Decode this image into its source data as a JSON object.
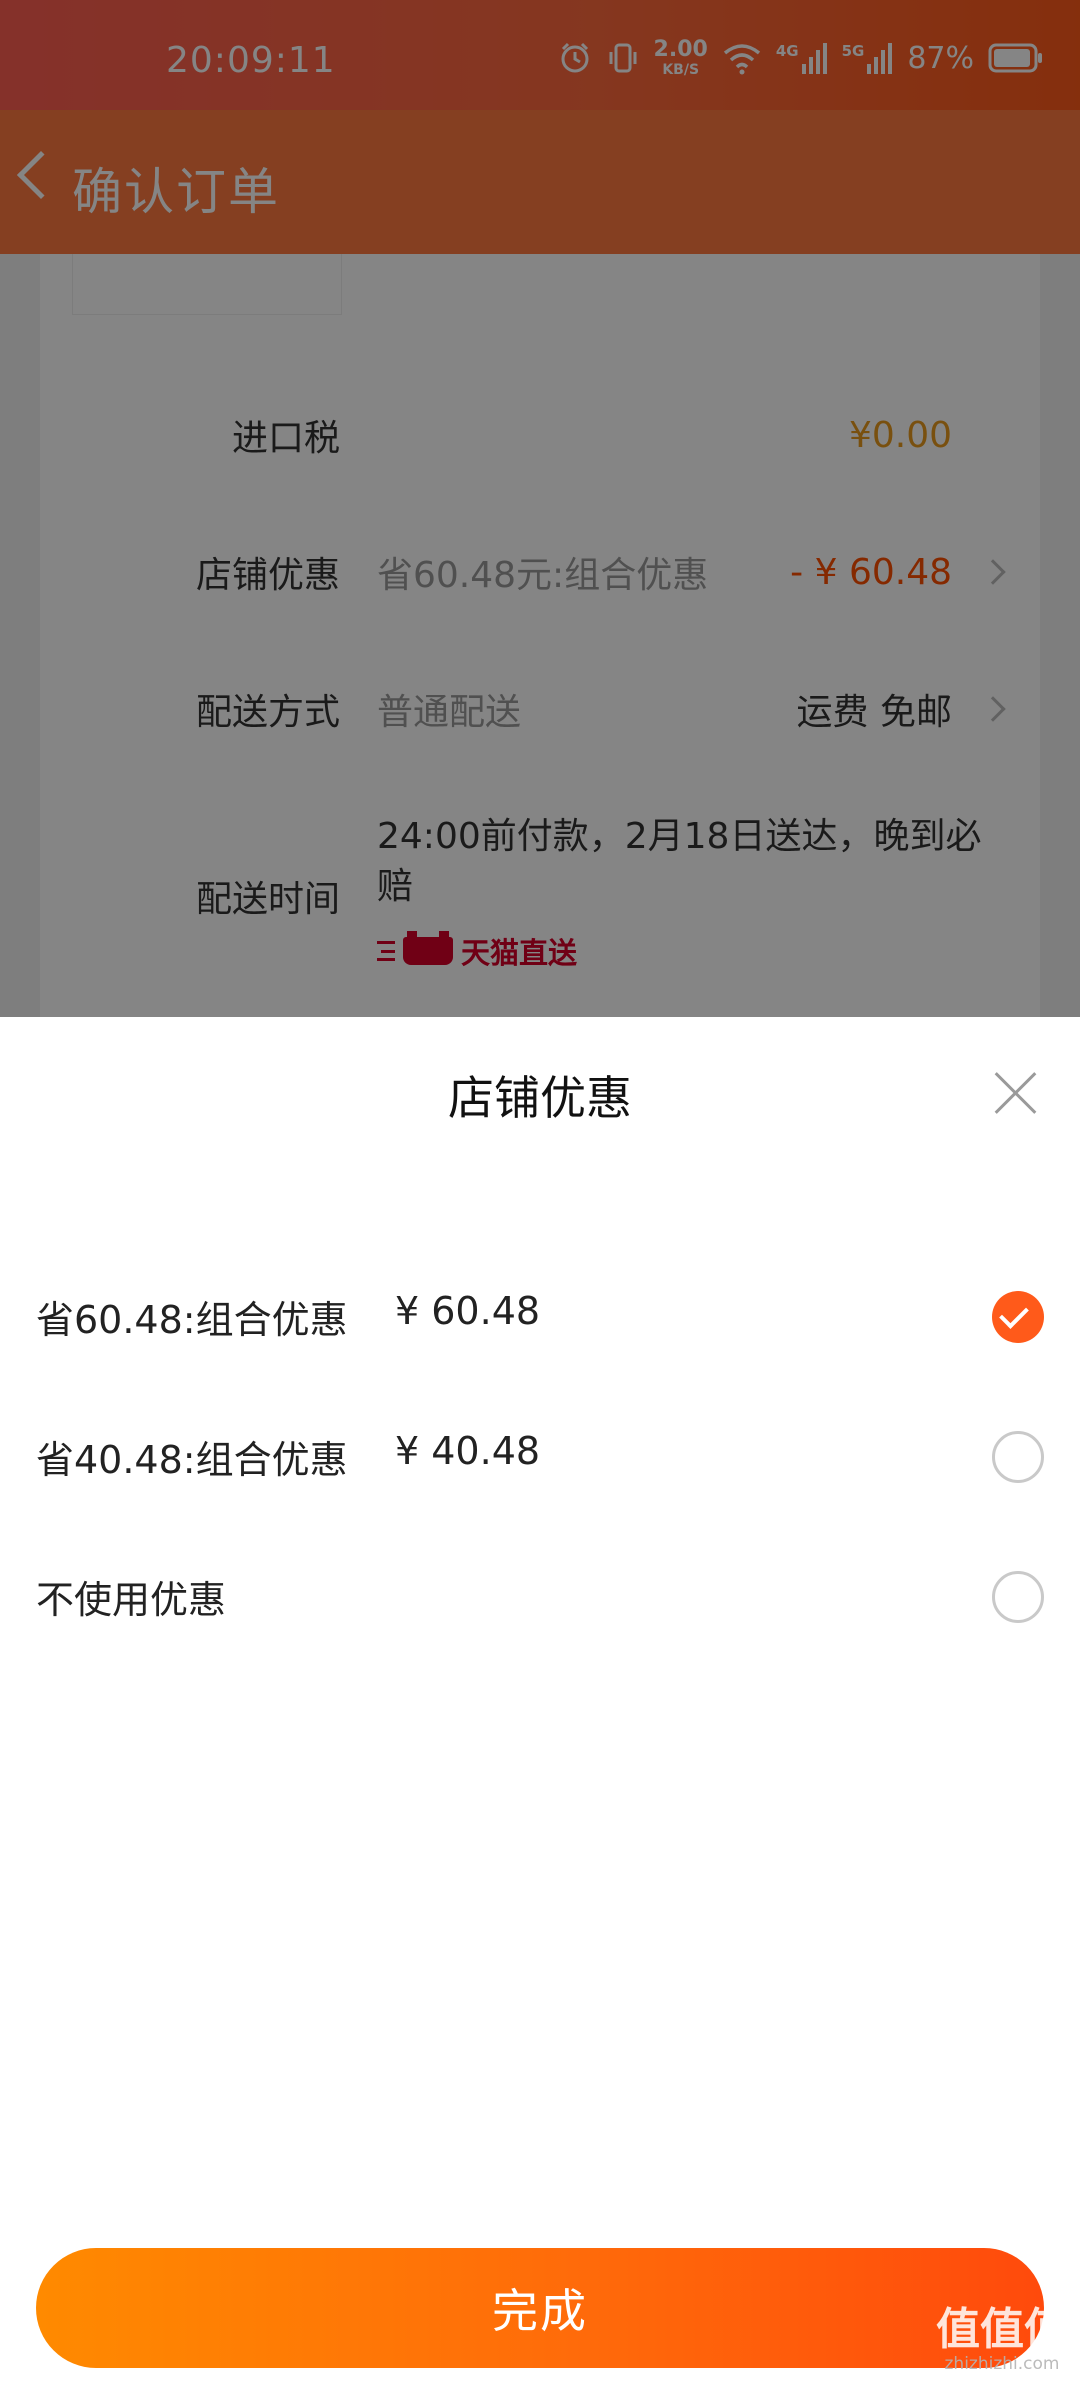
{
  "status_bar": {
    "time": "20:09:11",
    "net_speed_value": "2.00",
    "net_speed_unit": "KB/S",
    "sim1": "4G",
    "sim2": "5G",
    "battery": "87%"
  },
  "background_page": {
    "title": "确认订单",
    "rows": {
      "tax": {
        "label": "进口税",
        "value": "¥0.00"
      },
      "discount": {
        "label": "店铺优惠",
        "detail": "省60.48元:组合优惠",
        "value": "- ¥ 60.48"
      },
      "shipping": {
        "label": "配送方式",
        "detail": "普通配送",
        "value": "运费 免邮"
      },
      "delivery_time": {
        "label": "配送时间",
        "detail": "24:00前付款，2月18日送达，晚到必赔",
        "badge": "天猫直送"
      }
    }
  },
  "sheet": {
    "title": "店铺优惠",
    "options": [
      {
        "label": "省60.48:组合优惠",
        "amount": "¥ 60.48",
        "selected": true
      },
      {
        "label": "省40.48:组合优惠",
        "amount": "¥ 40.48",
        "selected": false
      },
      {
        "label": "不使用优惠",
        "amount": "",
        "selected": false
      }
    ],
    "done_label": "完成"
  },
  "watermark": {
    "main": "值值值",
    "sub": "zhizhizhi.com"
  },
  "colors": {
    "accent": "#ff5a1a",
    "price_orange": "#ff5000",
    "tax_yellow": "#e89a1e",
    "tmall_red": "#d6002a"
  }
}
